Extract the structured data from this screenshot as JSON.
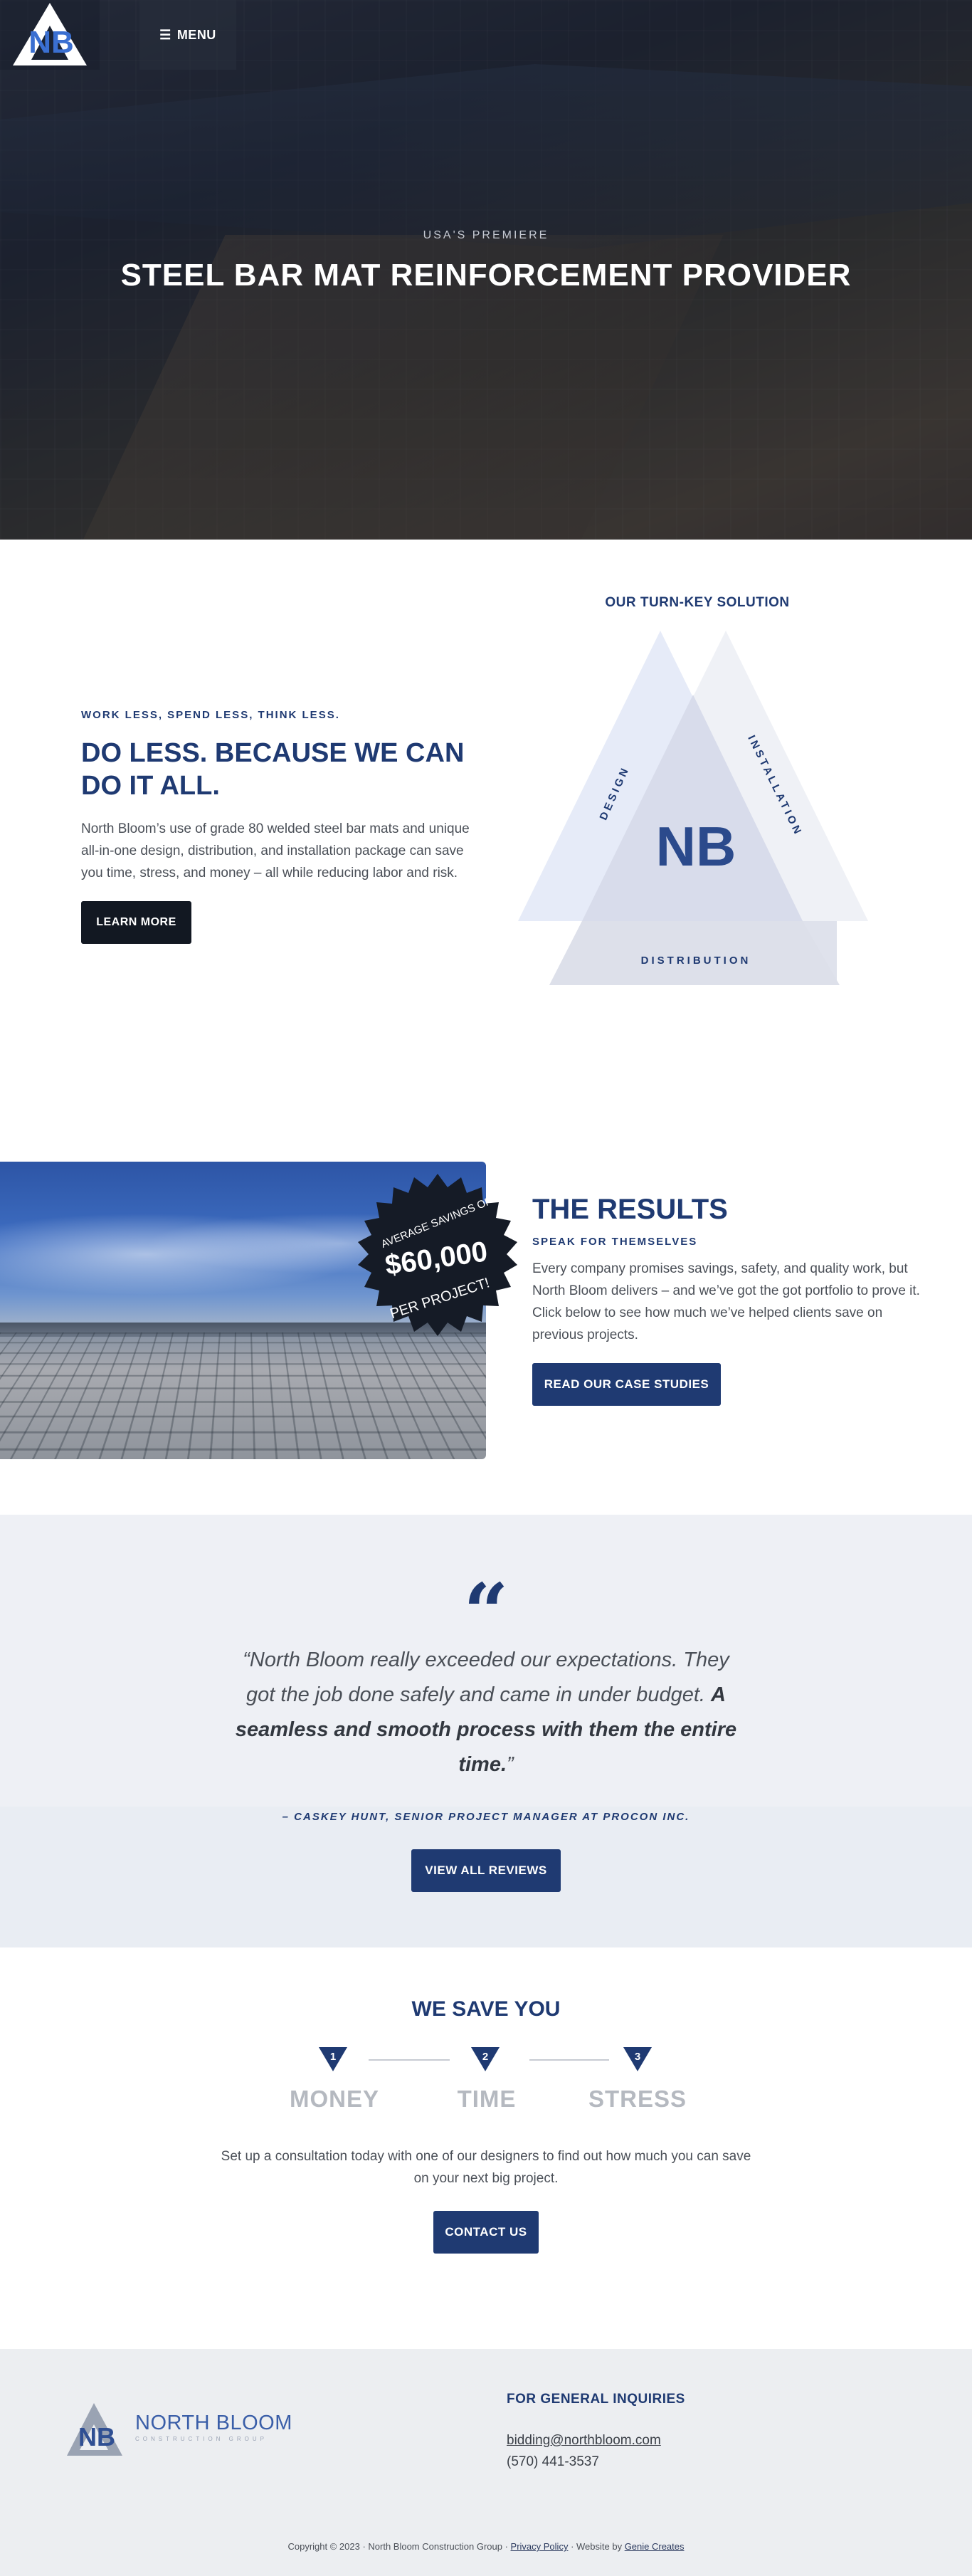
{
  "header": {
    "menu_icon": "hamburger-icon",
    "menu_label": "MENU",
    "logo_icon": "north-bloom-logo"
  },
  "hero": {
    "eyebrow": "USA'S PREMIERE",
    "title": "STEEL BAR MAT REINFORCEMENT PROVIDER"
  },
  "intro": {
    "eyebrow": "WORK LESS, SPEND LESS, THINK LESS.",
    "title": "DO LESS. BECAUSE WE CAN DO IT ALL.",
    "body": "North Bloom’s use of grade 80 welded steel bar mats and unique all-in-one design, distribution, and installation package can save you time, stress, and money – all while reducing labor and risk.",
    "button": "LEARN MORE"
  },
  "turnkey": {
    "title": "OUR TURN-KEY SOLUTION",
    "labels": [
      "DESIGN",
      "INSTALLATION",
      "DISTRIBUTION"
    ],
    "center_logo": "NB"
  },
  "results": {
    "badge_top": "AVERAGE SAVINGS OF",
    "badge_amount": "$60,000",
    "badge_bottom": "PER PROJECT!",
    "title": "THE RESULTS",
    "eyebrow": "SPEAK FOR THEMSELVES",
    "body": "Every company promises savings, safety, and quality work, but North Bloom delivers – and we’ve got the got portfolio to prove it. Click below to see how much we’ve helped clients save on previous projects.",
    "button": "READ OUR CASE STUDIES"
  },
  "testimonial": {
    "quote_icon": "quote-icon",
    "quote_plain": "“North Bloom really exceeded our expectations. They got the job done safely and came in under budget. ",
    "quote_bold": "A seamless and smooth process with them the entire time.",
    "quote_end": "”",
    "author": "– CASKEY HUNT, SENIOR PROJECT MANAGER AT PROCON INC.",
    "button": "VIEW ALL REVIEWS"
  },
  "save": {
    "title": "WE SAVE YOU",
    "steps": [
      {
        "num": "1",
        "word": "MONEY"
      },
      {
        "num": "2",
        "word": "TIME"
      },
      {
        "num": "3",
        "word": "STRESS"
      }
    ],
    "body": "Set up a consultation today with one of our designers to find out how much you can save on your next big project.",
    "button": "CONTACT US"
  },
  "footer": {
    "brand": "NORTH BLOOM",
    "brand_sub": "CONSTRUCTION GROUP",
    "inquiries_title": "FOR GENERAL INQUIRIES",
    "email": "bidding@northbloom.com",
    "phone": "(570) 441-3537",
    "copyright": "Copyright © 2023 · North Bloom Construction Group · ",
    "privacy": "Privacy Policy",
    "website_by": " · Website by ",
    "agency": "Genie Creates"
  },
  "colors": {
    "brand_blue": "#1f3a72",
    "dark_button": "#121822",
    "testimonial_bg": "#eef0f5",
    "footer_bg": "#eceef1"
  }
}
